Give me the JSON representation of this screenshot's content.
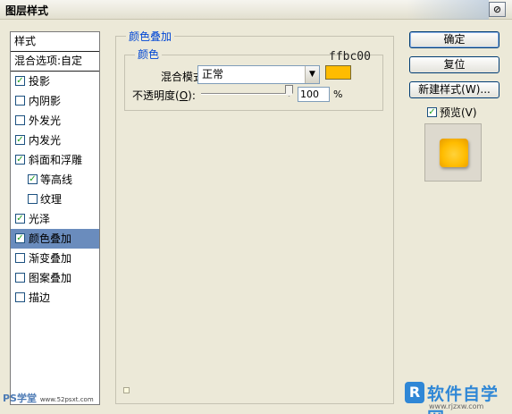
{
  "window": {
    "title": "图层样式",
    "close_icon": "⊘"
  },
  "styles_list": {
    "header": "样式",
    "blend_options": "混合选项:自定",
    "items": [
      {
        "label": "投影",
        "checked": true,
        "sub": false,
        "selected": false
      },
      {
        "label": "内阴影",
        "checked": false,
        "sub": false,
        "selected": false
      },
      {
        "label": "外发光",
        "checked": false,
        "sub": false,
        "selected": false
      },
      {
        "label": "内发光",
        "checked": true,
        "sub": false,
        "selected": false
      },
      {
        "label": "斜面和浮雕",
        "checked": true,
        "sub": false,
        "selected": false
      },
      {
        "label": "等高线",
        "checked": true,
        "sub": true,
        "selected": false
      },
      {
        "label": "纹理",
        "checked": false,
        "sub": true,
        "selected": false
      },
      {
        "label": "光泽",
        "checked": true,
        "sub": false,
        "selected": false
      },
      {
        "label": "颜色叠加",
        "checked": true,
        "sub": false,
        "selected": true
      },
      {
        "label": "渐变叠加",
        "checked": false,
        "sub": false,
        "selected": false
      },
      {
        "label": "图案叠加",
        "checked": false,
        "sub": false,
        "selected": false
      },
      {
        "label": "描边",
        "checked": false,
        "sub": false,
        "selected": false
      }
    ]
  },
  "panel": {
    "title": "颜色叠加",
    "group": "颜色",
    "hex_annotation": "ffbc00",
    "blend_mode_label": "混合模式:",
    "blend_mode_value": "正常",
    "overlay_color": "#ffbc00",
    "opacity_label_prefix": "不透明度(",
    "opacity_label_key": "O",
    "opacity_label_suffix": "):",
    "opacity_value": "100",
    "opacity_unit": "%"
  },
  "buttons": {
    "ok": "确定",
    "reset": "复位",
    "new_style": "新建样式(W)...",
    "preview_label": "预览(V)",
    "preview_checked": true
  },
  "watermarks": {
    "left": "PS学堂",
    "left_url": "www.52psxt.com",
    "right_logo": "R",
    "right_name": "软件自学网",
    "right_url": "www.rjzxw.com"
  }
}
